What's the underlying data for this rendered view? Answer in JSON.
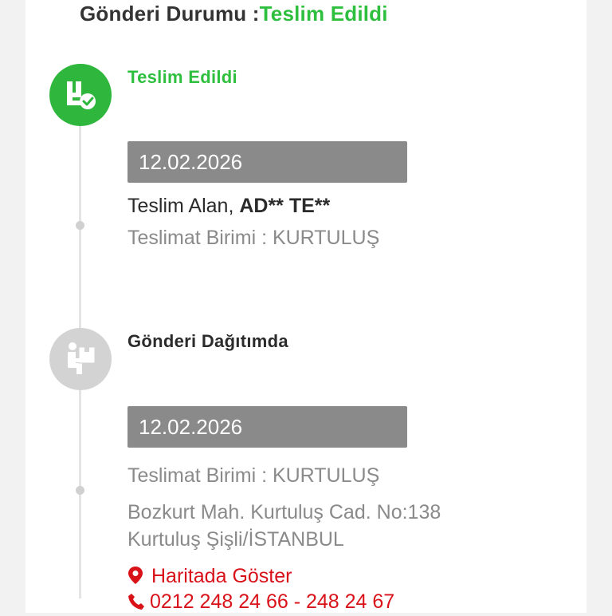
{
  "header": {
    "label": "Gönderi Durumu :",
    "status": "Teslim Edildi"
  },
  "steps": [
    {
      "title": "Teslim Edildi",
      "icon": "delivered-box-check-icon",
      "color": "#2fb63c",
      "date": "12.02.2026",
      "receiver_label": "Teslim Alan,",
      "receiver_name": "AD** TE**",
      "unit": "Teslimat Birimi : KURTULUŞ"
    },
    {
      "title": "Gönderi Dağıtımda",
      "icon": "courier-carrying-box-icon",
      "color": "#d3d3d3",
      "date": "12.02.2026",
      "unit": "Teslimat Birimi : KURTULUŞ",
      "address_line1": "Bozkurt Mah. Kurtuluş Cad. No:138",
      "address_line2": "Kurtuluş Şişli/İSTANBUL",
      "map_link": "Haritada Göster",
      "phone": "0212 248 24 66 - 248 24 67"
    }
  ],
  "colors": {
    "accent_green": "#2fbf3f",
    "link_red": "#d9121a",
    "date_box": "#8a8a8a"
  }
}
